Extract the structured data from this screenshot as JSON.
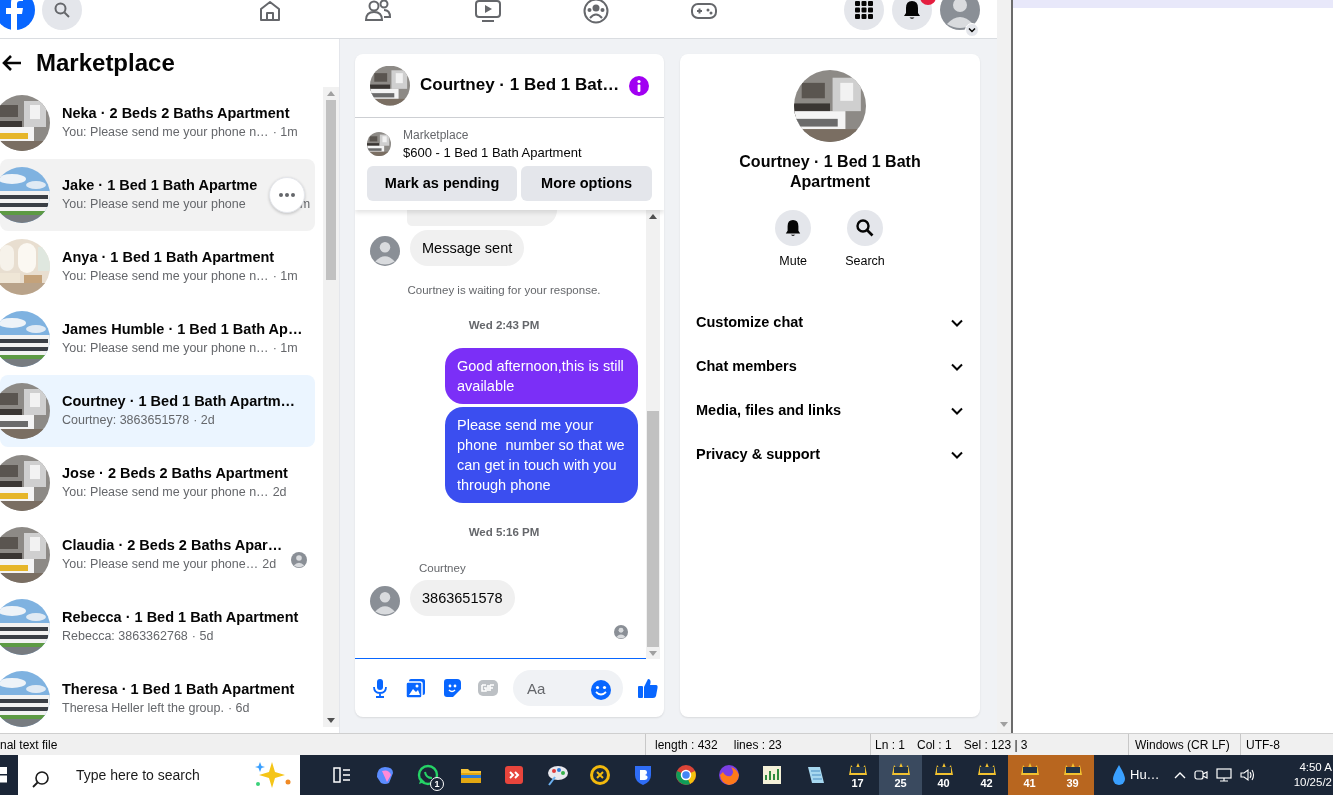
{
  "top_nav": {
    "has_notification": true
  },
  "sidebar": {
    "title": "Marketplace",
    "conversations": [
      {
        "title": "Neka · 2 Beds 2 Baths Apartment",
        "preview": "You: Please send me your phone n…",
        "time": "· 1m",
        "selected": false,
        "hovered": false,
        "seen": false
      },
      {
        "title": "Jake · 1 Bed 1 Bath Apartme",
        "preview": "You: Please send me your phone",
        "time": "m",
        "selected": false,
        "hovered": true,
        "seen": false
      },
      {
        "title": "Anya · 1 Bed 1 Bath Apartment",
        "preview": "You: Please send me your phone n…",
        "time": "· 1m",
        "selected": false,
        "hovered": false,
        "seen": false
      },
      {
        "title": "James Humble · 1 Bed 1 Bath Ap…",
        "preview": "You: Please send me your phone n…",
        "time": "· 1m",
        "selected": false,
        "hovered": false,
        "seen": false
      },
      {
        "title": "Courtney · 1 Bed 1 Bath Apartm…",
        "preview": "Courtney: 3863651578",
        "time": "· 2d",
        "selected": true,
        "hovered": false,
        "seen": false
      },
      {
        "title": "Jose · 2 Beds 2 Baths Apartment",
        "preview": "You: Please send me your phone n…",
        "time": "2d",
        "selected": false,
        "hovered": false,
        "seen": false
      },
      {
        "title": "Claudia · 2 Beds 2 Baths Apar…",
        "preview": "You: Please send me your phone…",
        "time": "2d",
        "selected": false,
        "hovered": false,
        "seen": true
      },
      {
        "title": "Rebecca · 1 Bed 1 Bath Apartment",
        "preview": "Rebecca: 3863362768",
        "time": "· 5d",
        "selected": false,
        "hovered": false,
        "seen": false
      },
      {
        "title": "Theresa · 1 Bed 1 Bath Apartment",
        "preview": "Theresa Heller left the group.",
        "time": "· 6d",
        "selected": false,
        "hovered": false,
        "seen": false
      }
    ]
  },
  "chat": {
    "title": "Courtney · 1 Bed 1 Bat…",
    "listing": {
      "source": "Marketplace",
      "title": "$600 - 1 Bed 1 Bath Apartment"
    },
    "actions": [
      "Mark as pending",
      "More options"
    ],
    "messages": [
      {
        "kind": "partial"
      },
      {
        "kind": "incoming",
        "text": "Message sent"
      },
      {
        "kind": "notice",
        "text": "Courtney is waiting for your response."
      },
      {
        "kind": "timestamp",
        "text": "Wed 2:43 PM"
      },
      {
        "kind": "outgoing",
        "text": "Good afternoon,this is still available",
        "color": "#7b2ff7"
      },
      {
        "kind": "outgoing",
        "text": "Please send me your phone  number so that we can get in touch with you through phone",
        "color": "#3b4ef0"
      },
      {
        "kind": "timestamp",
        "text": "Wed 5:16 PM"
      },
      {
        "kind": "sender",
        "text": "Courtney"
      },
      {
        "kind": "incoming",
        "text": "3863651578"
      },
      {
        "kind": "receipt"
      }
    ],
    "composer": {
      "placeholder": "Aa"
    }
  },
  "details": {
    "title": "Courtney · 1 Bed 1 Bath Apartment",
    "actions": [
      {
        "kind": "mute",
        "label": "Mute"
      },
      {
        "kind": "search",
        "label": "Search"
      }
    ],
    "sections": [
      {
        "label": "Customize chat",
        "expanded": false
      },
      {
        "label": "Chat members",
        "expanded": false
      },
      {
        "label": "Media, files and links",
        "expanded": false
      },
      {
        "label": "Privacy & support",
        "expanded": false
      }
    ]
  },
  "status_bar": {
    "file_type": "nal text file",
    "length": "length : 432",
    "lines": "lines : 23",
    "line": "Ln : 1",
    "column": "Col : 1",
    "selection": "Sel : 123 | 3",
    "line_endings": "Windows (CR LF)",
    "encoding": "UTF-8"
  },
  "taskbar": {
    "search_placeholder": "Type here to search",
    "chat_badge": "1",
    "pinned": [
      {
        "label": "17",
        "active": false,
        "attention": false
      },
      {
        "label": "25",
        "active": true,
        "attention": false
      },
      {
        "label": "40",
        "active": false,
        "attention": false
      },
      {
        "label": "42",
        "active": false,
        "attention": false
      },
      {
        "label": "41",
        "active": false,
        "attention": true
      },
      {
        "label": "39",
        "active": false,
        "attention": true
      }
    ],
    "weather": "Hu…",
    "time": "4:50 A",
    "date": "10/25/2"
  }
}
